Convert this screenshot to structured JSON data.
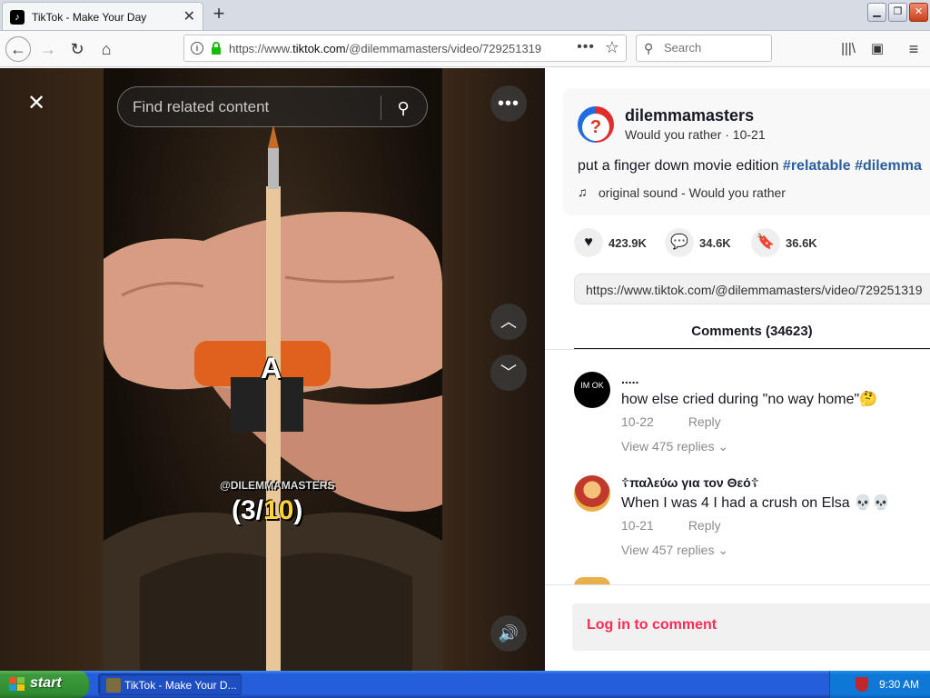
{
  "browser": {
    "tab_title": "TikTok - Make Your Day",
    "url_prefix": "https://www.",
    "url_domain": "tiktok.com",
    "url_rest": "/@dilemmamasters/video/729251319",
    "search_placeholder": "Search"
  },
  "video": {
    "search_placeholder": "Find related content",
    "caption_letter": "A",
    "watermark": "@DILEMMAMASTERS",
    "counter_open": "(3/",
    "counter_num": "10",
    "counter_close": ")"
  },
  "post": {
    "author": "dilemmamasters",
    "subtitle": "Would you rather · 10-21",
    "description": "put a finger down movie edition ",
    "hashtags": "#relatable #dilemma",
    "sound": "original sound - Would you rather",
    "likes": "423.9K",
    "comments_count": "34.6K",
    "saves": "36.6K",
    "link": "https://www.tiktok.com/@dilemmamasters/video/729251319",
    "comments_tab": "Comments (34623)"
  },
  "comments": [
    {
      "avatar_text": "IM OK",
      "name": ".....",
      "text": "how else cried during \"no way home\"🤔",
      "date": "10-22",
      "reply": "Reply",
      "replies": "View 475 replies"
    },
    {
      "name": "☦παλεύω για τον Θεό☦",
      "text": "When I was 4 I had a crush on Elsa 💀💀",
      "date": "10-21",
      "reply": "Reply",
      "replies": "View 457 replies"
    }
  ],
  "login_label": "Log in to comment",
  "taskbar": {
    "start": "start",
    "task": "TikTok - Make Your D...",
    "clock": "9:30 AM"
  },
  "colors": {
    "accent": "#fe2c55",
    "hashtag": "#2b5d9d",
    "taskbar": "#245edb"
  }
}
